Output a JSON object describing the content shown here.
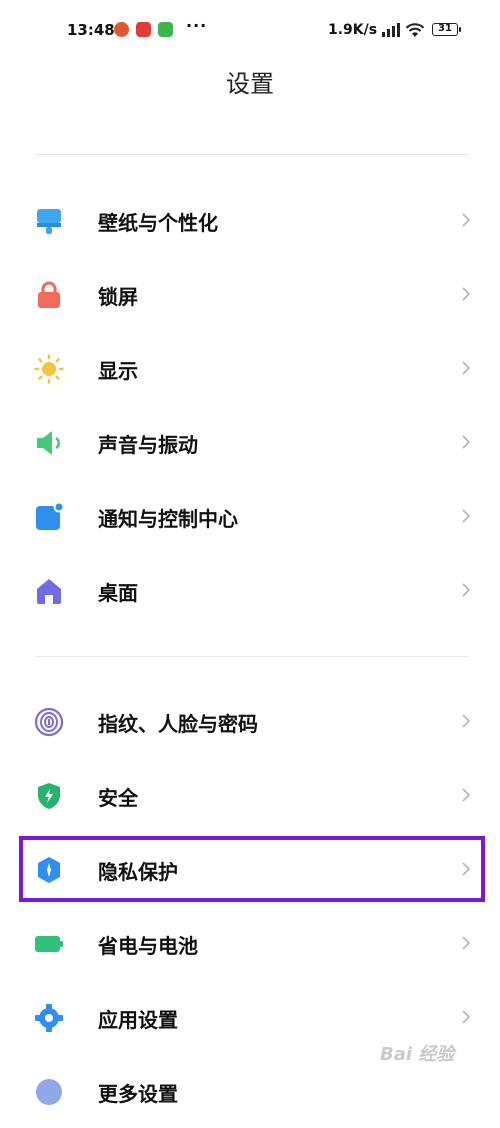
{
  "status_bar": {
    "time": "13:48",
    "more": "···",
    "net_speed": "1.9K/s",
    "battery": "31"
  },
  "header": {
    "title": "设置"
  },
  "settings": {
    "items": [
      {
        "label": "壁纸与个性化",
        "icon": "wallpaper-icon",
        "color": "#3ea7ef"
      },
      {
        "label": "锁屏",
        "icon": "lock-icon",
        "color": "#f26a5a"
      },
      {
        "label": "显示",
        "icon": "sun-icon",
        "color": "#f7c43d"
      },
      {
        "label": "声音与振动",
        "icon": "speaker-icon",
        "color": "#45c977"
      },
      {
        "label": "通知与控制中心",
        "icon": "notification-icon",
        "color": "#2f8ff0"
      },
      {
        "label": "桌面",
        "icon": "home-icon",
        "color": "#6f6de6"
      },
      {
        "label": "指纹、人脸与密码",
        "icon": "fingerprint-icon",
        "color": "#7b6ce0"
      },
      {
        "label": "安全",
        "icon": "shield-icon",
        "color": "#26b46a"
      },
      {
        "label": "隐私保护",
        "icon": "privacy-icon",
        "color": "#2f8ff0"
      },
      {
        "label": "省电与电池",
        "icon": "battery-icon",
        "color": "#2fc07a"
      },
      {
        "label": "应用设置",
        "icon": "gear-icon",
        "color": "#2f8ff0"
      },
      {
        "label": "更多设置",
        "icon": "more-settings-icon",
        "color": "#8fa8e8"
      }
    ]
  },
  "highlight": {
    "color": "#7a17d8"
  },
  "watermark": "Bai 经验"
}
